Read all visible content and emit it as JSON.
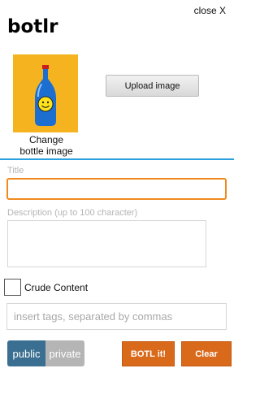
{
  "header": {
    "close_label": "close X",
    "app_title": "botlr"
  },
  "image": {
    "caption": "Change\nbottle image",
    "upload_label": "Upload image",
    "thumb_bg": "#f5b41f"
  },
  "form": {
    "title_label": "Title",
    "title_value": "",
    "desc_label": "Description (up to 100 character)",
    "desc_value": "",
    "crude_label": "Crude Content",
    "crude_checked": false,
    "tags_placeholder": "insert tags, separated by commas"
  },
  "visibility": {
    "public_label": "public",
    "private_label": "private",
    "selected": "public"
  },
  "actions": {
    "submit_label": "BOTL it!",
    "clear_label": "Clear"
  },
  "colors": {
    "accent": "#f08a1d",
    "divider": "#2aa0e0",
    "action": "#d96a1c",
    "toggle_active": "#3b6f92",
    "toggle_inactive": "#b5b5b5"
  }
}
